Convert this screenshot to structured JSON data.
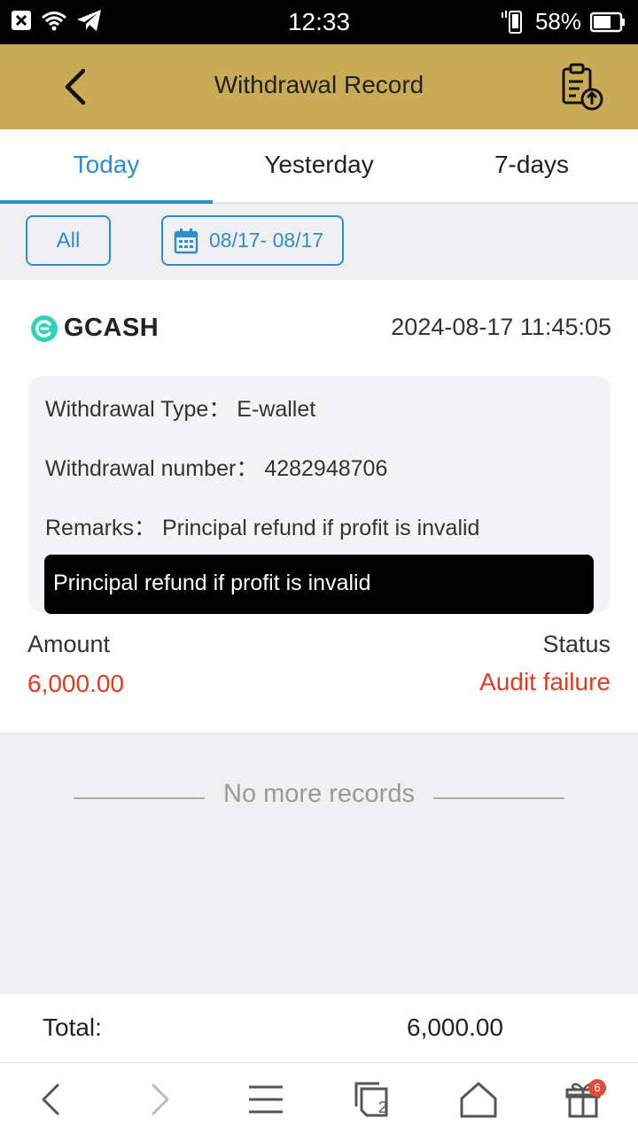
{
  "status_bar": {
    "time": "12:33",
    "battery": "58%"
  },
  "header": {
    "title": "Withdrawal Record"
  },
  "tabs": [
    {
      "label": "Today",
      "active": true
    },
    {
      "label": "Yesterday",
      "active": false
    },
    {
      "label": "7-days",
      "active": false
    }
  ],
  "filters": {
    "all_label": "All",
    "date_range": "08/17- 08/17"
  },
  "record": {
    "brand": "GCASH",
    "datetime": "2024-08-17 11:45:05",
    "type_label": "Withdrawal Type：",
    "type_value": "E-wallet",
    "number_label": "Withdrawal number：",
    "number_value": "4282948706",
    "remarks_label": "Remarks：",
    "remarks_value": "Principal refund if profit is invalid",
    "tooltip": "Principal refund if profit is invalid",
    "amount_label": "Amount",
    "amount_value": "6,000.00",
    "status_label": "Status",
    "status_value": "Audit failure"
  },
  "no_more": "No more records",
  "total": {
    "label": "Total:",
    "value": "6,000.00"
  },
  "navbar": {
    "tabs_count": "2",
    "gift_badge": "6"
  },
  "colors": {
    "header_bg": "#c9aa57",
    "accent": "#2a8fd0",
    "error": "#e23b1f"
  }
}
